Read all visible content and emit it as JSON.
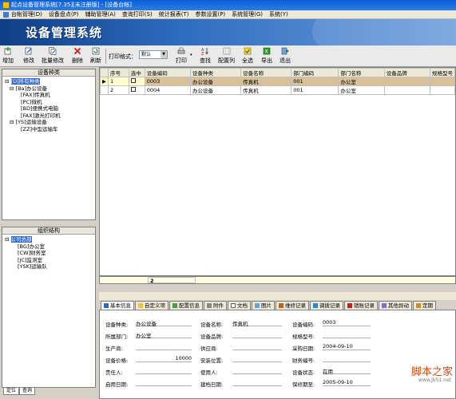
{
  "window": {
    "title": "起点设备管理系统[7.35][未注册版] - [设备台帐]"
  },
  "menu": [
    {
      "label": "台帐管理(D)"
    },
    {
      "label": "设备盘点(P)"
    },
    {
      "label": "辅助管理(A)"
    },
    {
      "label": "查询打印(S)"
    },
    {
      "label": "统计报表(T)"
    },
    {
      "label": "参数设置(P)"
    },
    {
      "label": "系统管理(G)"
    },
    {
      "label": "系统(Y)"
    }
  ],
  "banner": {
    "title": "设备管理系统"
  },
  "toolbar": {
    "add": "增加",
    "edit": "修改",
    "batch_edit": "批量修改",
    "delete": "删除",
    "refresh": "刷新",
    "print_format_label": "打印格式：",
    "print_format_value": "默认",
    "print": "打印",
    "find": "查找",
    "config_columns": "配置列",
    "select_all": "全选",
    "export": "导出",
    "exit": "退出"
  },
  "category_panel": {
    "title": "设备种类",
    "items": [
      "[D]所有种类",
      "[Ba]办公设备",
      "[FAX]传真机",
      "[PC]微机",
      "[BD]便携式电脑",
      "[FAX]激光打印机",
      "[YS]运输设备",
      "[ZZ]中型运输车"
    ]
  },
  "org_panel": {
    "title": "组织结构",
    "items": [
      "公司总部",
      "[BG]办公室",
      "[CW]财务室",
      "[JC]监测室",
      "[YSK]运输队"
    ]
  },
  "left_tabs": [
    "定位",
    "查询"
  ],
  "grid": {
    "columns": [
      "序号",
      "选中",
      "设备编码",
      "设备种类",
      "设备名称",
      "部门编码",
      "部门名称",
      "设备品牌",
      "规格型号"
    ],
    "rows": [
      {
        "index": "1",
        "code": "0003",
        "category": "办公设备",
        "name": "传真机",
        "dept_code": "001",
        "dept_name": "办公室",
        "brand": "",
        "model": ""
      },
      {
        "index": "2",
        "code": "0004",
        "category": "办公设备",
        "name": "传真机",
        "dept_code": "001",
        "dept_name": "办公室",
        "brand": "",
        "model": ""
      }
    ],
    "footer_count": "2"
  },
  "detail_tabs": [
    "基本信息",
    "自定义项",
    "配置信息",
    "附件",
    "文档",
    "图片",
    "维修记录",
    "调拨记录",
    "销账记录",
    "其他异动",
    "定期"
  ],
  "form": {
    "category_label": "设备种类:",
    "category_value": "办公设备",
    "name_label": "设备名称:",
    "name_value": "传真机",
    "code_label": "设备编码:",
    "code_value": "0003",
    "dept_label": "所属部门:",
    "dept_value": "办公室",
    "brand_label": "设备品牌:",
    "brand_value": "",
    "model_label": "规格型号:",
    "model_value": "",
    "maker_label": "生产商:",
    "maker_value": "",
    "supplier_label": "供应商:",
    "supplier_value": "",
    "purchase_date_label": "采购日期:",
    "purchase_date_value": "2004-09-10",
    "price_label": "设备价格:",
    "price_value": "10000",
    "location_label": "安装位置:",
    "location_value": "",
    "asset_no_label": "财务编号:",
    "asset_no_value": "",
    "owner_label": "责任人:",
    "owner_value": "",
    "user_label": "使用人:",
    "user_value": "",
    "status_label": "设备状态:",
    "status_value": "在用",
    "enable_date_label": "启用日期:",
    "enable_date_value": "",
    "build_date_label": "建档日期:",
    "build_date_value": "",
    "warranty_label": "保修期至:",
    "warranty_value": "2005-09-10"
  },
  "watermark": {
    "text": "脚本之家",
    "sub": "www.jb51.net"
  },
  "colors": {
    "selection": "#3169c6",
    "row_highlight": "#d8c098",
    "banner": "#1e56a8"
  }
}
